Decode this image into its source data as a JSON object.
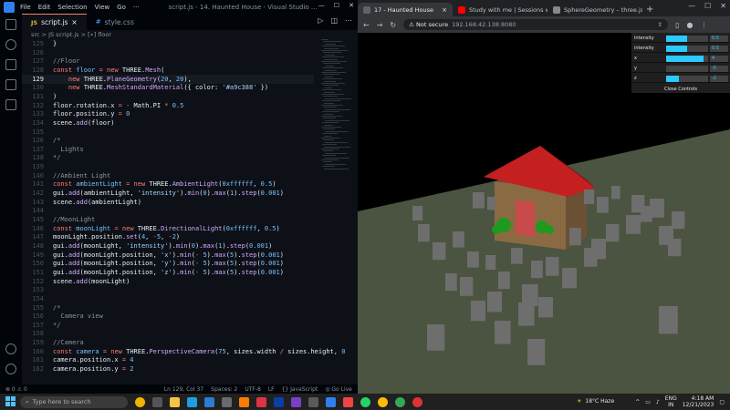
{
  "vscode": {
    "menu": [
      "File",
      "Edit",
      "Selection",
      "View",
      "Go",
      "···"
    ],
    "window_title": "script.js - 14. Haunted House - Visual Studio ...",
    "tabs": [
      {
        "badge": "JS",
        "name": "script.js"
      },
      {
        "badge": "#",
        "name": "style.css"
      }
    ],
    "breadcrumb": "src > JS script.js > [∙] floor",
    "code_lines": [
      {
        "n": "125",
        "html": "<span class='c-var'>}</span>"
      },
      {
        "n": "126",
        "html": ""
      },
      {
        "n": "127",
        "html": "<span class='c-cmt'>//Floor</span>"
      },
      {
        "n": "128",
        "html": "<span class='c-kw'>const</span> <span class='c-prop'>floor</span> <span class='c-kw'>=</span> <span class='c-kw'>new</span> <span class='c-var'>THREE.</span><span class='c-cls'>Mesh</span><span class='c-var'>(</span>"
      },
      {
        "n": "129",
        "html": "    <span class='c-kw'>new</span> <span class='c-var'>THREE.</span><span class='c-cls'>PlaneGeometry</span><span class='c-var'>(</span><span class='c-num'>20</span><span class='c-var'>, </span><span class='c-num'>20</span><span class='c-var'>),</span>",
        "current": true
      },
      {
        "n": "130",
        "html": "    <span class='c-kw'>new</span> <span class='c-var'>THREE.</span><span class='c-cls'>MeshStandardMaterial</span><span class='c-var'>({ color: </span><span class='c-str'>'#a9c388'</span><span class='c-var'> })</span>"
      },
      {
        "n": "131",
        "html": "<span class='c-var'>)</span>"
      },
      {
        "n": "132",
        "html": "<span class='c-var'>floor.rotation.x </span><span class='c-kw'>=</span> <span class='c-kw'>-</span> <span class='c-var'>Math.PI </span><span class='c-kw'>*</span> <span class='c-num'>0.5</span>"
      },
      {
        "n": "133",
        "html": "<span class='c-var'>floor.position.y </span><span class='c-kw'>=</span> <span class='c-num'>0</span>"
      },
      {
        "n": "134",
        "html": "<span class='c-var'>scene.</span><span class='c-cls'>add</span><span class='c-var'>(floor)</span>"
      },
      {
        "n": "135",
        "html": ""
      },
      {
        "n": "136",
        "html": "<span class='c-cmt'>/*</span>"
      },
      {
        "n": "137",
        "html": "<span class='c-cmt'>  Lights</span>"
      },
      {
        "n": "138",
        "html": "<span class='c-cmt'>*/</span>"
      },
      {
        "n": "139",
        "html": ""
      },
      {
        "n": "140",
        "html": "<span class='c-cmt'>//Ambient Light</span>"
      },
      {
        "n": "141",
        "html": "<span class='c-kw'>const</span> <span class='c-prop'>ambientLight</span> <span class='c-kw'>=</span> <span class='c-kw'>new</span> <span class='c-var'>THREE.</span><span class='c-cls'>AmbientLight</span><span class='c-var'>(</span><span class='c-num'>0xffffff</span><span class='c-var'>, </span><span class='c-num'>0.5</span><span class='c-var'>)</span>"
      },
      {
        "n": "142",
        "html": "<span class='c-var'>gui.</span><span class='c-cls'>add</span><span class='c-var'>(ambientLight, </span><span class='c-str'>'intensity'</span><span class='c-var'>).</span><span class='c-cls'>min</span><span class='c-var'>(</span><span class='c-num'>0</span><span class='c-var'>).</span><span class='c-cls'>max</span><span class='c-var'>(</span><span class='c-num'>1</span><span class='c-var'>).</span><span class='c-cls'>step</span><span class='c-var'>(</span><span class='c-num'>0.001</span><span class='c-var'>)</span>"
      },
      {
        "n": "143",
        "html": "<span class='c-var'>scene.</span><span class='c-cls'>add</span><span class='c-var'>(ambientLight)</span>"
      },
      {
        "n": "144",
        "html": ""
      },
      {
        "n": "145",
        "html": "<span class='c-cmt'>//MoonLight</span>"
      },
      {
        "n": "146",
        "html": "<span class='c-kw'>const</span> <span class='c-prop'>moonLight</span> <span class='c-kw'>=</span> <span class='c-kw'>new</span> <span class='c-var'>THREE.</span><span class='c-cls'>DirectionalLight</span><span class='c-var'>(</span><span class='c-num'>0xffffff</span><span class='c-var'>, </span><span class='c-num'>0.5</span><span class='c-var'>)</span>"
      },
      {
        "n": "147",
        "html": "<span class='c-var'>moonLight.position.</span><span class='c-cls'>set</span><span class='c-var'>(</span><span class='c-num'>4</span><span class='c-var'>, </span><span class='c-kw'>-</span><span class='c-num'>5</span><span class='c-var'>, </span><span class='c-kw'>-</span><span class='c-num'>2</span><span class='c-var'>)</span>"
      },
      {
        "n": "148",
        "html": "<span class='c-var'>gui.</span><span class='c-cls'>add</span><span class='c-var'>(moonLight, </span><span class='c-str'>'intensity'</span><span class='c-var'>).</span><span class='c-cls'>min</span><span class='c-var'>(</span><span class='c-num'>0</span><span class='c-var'>).</span><span class='c-cls'>max</span><span class='c-var'>(</span><span class='c-num'>1</span><span class='c-var'>).</span><span class='c-cls'>step</span><span class='c-var'>(</span><span class='c-num'>0.001</span><span class='c-var'>)</span>"
      },
      {
        "n": "149",
        "html": "<span class='c-var'>gui.</span><span class='c-cls'>add</span><span class='c-var'>(moonLight.position, </span><span class='c-str'>'x'</span><span class='c-var'>).</span><span class='c-cls'>min</span><span class='c-var'>(</span><span class='c-kw'>-</span> <span class='c-num'>5</span><span class='c-var'>).</span><span class='c-cls'>max</span><span class='c-var'>(</span><span class='c-num'>5</span><span class='c-var'>).</span><span class='c-cls'>step</span><span class='c-var'>(</span><span class='c-num'>0.001</span><span class='c-var'>)</span>"
      },
      {
        "n": "150",
        "html": "<span class='c-var'>gui.</span><span class='c-cls'>add</span><span class='c-var'>(moonLight.position, </span><span class='c-str'>'y'</span><span class='c-var'>).</span><span class='c-cls'>min</span><span class='c-var'>(</span><span class='c-kw'>-</span> <span class='c-num'>5</span><span class='c-var'>).</span><span class='c-cls'>max</span><span class='c-var'>(</span><span class='c-num'>5</span><span class='c-var'>).</span><span class='c-cls'>step</span><span class='c-var'>(</span><span class='c-num'>0.001</span><span class='c-var'>)</span>"
      },
      {
        "n": "151",
        "html": "<span class='c-var'>gui.</span><span class='c-cls'>add</span><span class='c-var'>(moonLight.position, </span><span class='c-str'>'z'</span><span class='c-var'>).</span><span class='c-cls'>min</span><span class='c-var'>(</span><span class='c-kw'>-</span> <span class='c-num'>5</span><span class='c-var'>).</span><span class='c-cls'>max</span><span class='c-var'>(</span><span class='c-num'>5</span><span class='c-var'>).</span><span class='c-cls'>step</span><span class='c-var'>(</span><span class='c-num'>0.001</span><span class='c-var'>)</span>"
      },
      {
        "n": "152",
        "html": "<span class='c-var'>scene.</span><span class='c-cls'>add</span><span class='c-var'>(moonLight)</span>"
      },
      {
        "n": "153",
        "html": ""
      },
      {
        "n": "154",
        "html": ""
      },
      {
        "n": "155",
        "html": "<span class='c-cmt'>/*</span>"
      },
      {
        "n": "156",
        "html": "<span class='c-cmt'>  Camera view</span>"
      },
      {
        "n": "157",
        "html": "<span class='c-cmt'>*/</span>"
      },
      {
        "n": "158",
        "html": ""
      },
      {
        "n": "159",
        "html": "<span class='c-cmt'>//Camera</span>"
      },
      {
        "n": "160",
        "html": "<span class='c-kw'>const</span> <span class='c-prop'>camera</span> <span class='c-kw'>=</span> <span class='c-kw'>new</span> <span class='c-var'>THREE.</span><span class='c-cls'>PerspectiveCamera</span><span class='c-var'>(</span><span class='c-num'>75</span><span class='c-var'>, sizes.width </span><span class='c-kw'>/</span><span class='c-var'> sizes.height, </span><span class='c-num'>0</span>"
      },
      {
        "n": "161",
        "html": "<span class='c-var'>camera.position.x </span><span class='c-kw'>=</span> <span class='c-num'>4</span>"
      },
      {
        "n": "162",
        "html": "<span class='c-var'>camera.position.y </span><span class='c-kw'>=</span> <span class='c-num'>2</span>"
      }
    ],
    "status": {
      "left": "⊗ 0 ⚠ 0",
      "position": "Ln 129, Col 37",
      "spaces": "Spaces: 2",
      "encoding": "UTF-8",
      "eol": "LF",
      "language": "{} JavaScript",
      "live": "◎ Go Live"
    }
  },
  "browser": {
    "tabs": [
      {
        "title": "17 - Haunted House",
        "fav_color": "#5f6368",
        "active": true
      },
      {
        "title": "Study with me | Sessions with |",
        "fav_color": "#ff0000",
        "active": false
      },
      {
        "title": "SphereGeometry – three.js docs",
        "fav_color": "#888888",
        "active": false
      }
    ],
    "new_tab": "+",
    "not_secure": "⚠ Not secure",
    "url": "192.168.42.138:8080",
    "gui": {
      "rows": [
        {
          "label": "intensity",
          "value": "0.5",
          "fraction": 0.5
        },
        {
          "label": "intensity",
          "value": "0.5",
          "fraction": 0.5
        },
        {
          "label": "x",
          "value": "4",
          "fraction": 0.9
        },
        {
          "label": "y",
          "value": "-5",
          "fraction": 0.0
        },
        {
          "label": "z",
          "value": "-2",
          "fraction": 0.3
        }
      ],
      "close": "Close Controls"
    }
  },
  "taskbar": {
    "search_placeholder": "Type here to search",
    "weather": "18°C  Haze",
    "lang_top": "ENG",
    "lang_bottom": "IN",
    "time": "4:18 AM",
    "date": "12/21/2023"
  },
  "colors": {
    "floor": "#a9c388",
    "roof": "#cc2222",
    "walls": "#8a6a42",
    "door": "#c84a4a",
    "bush": "#22aa22",
    "grave": "#6e6e6e"
  }
}
